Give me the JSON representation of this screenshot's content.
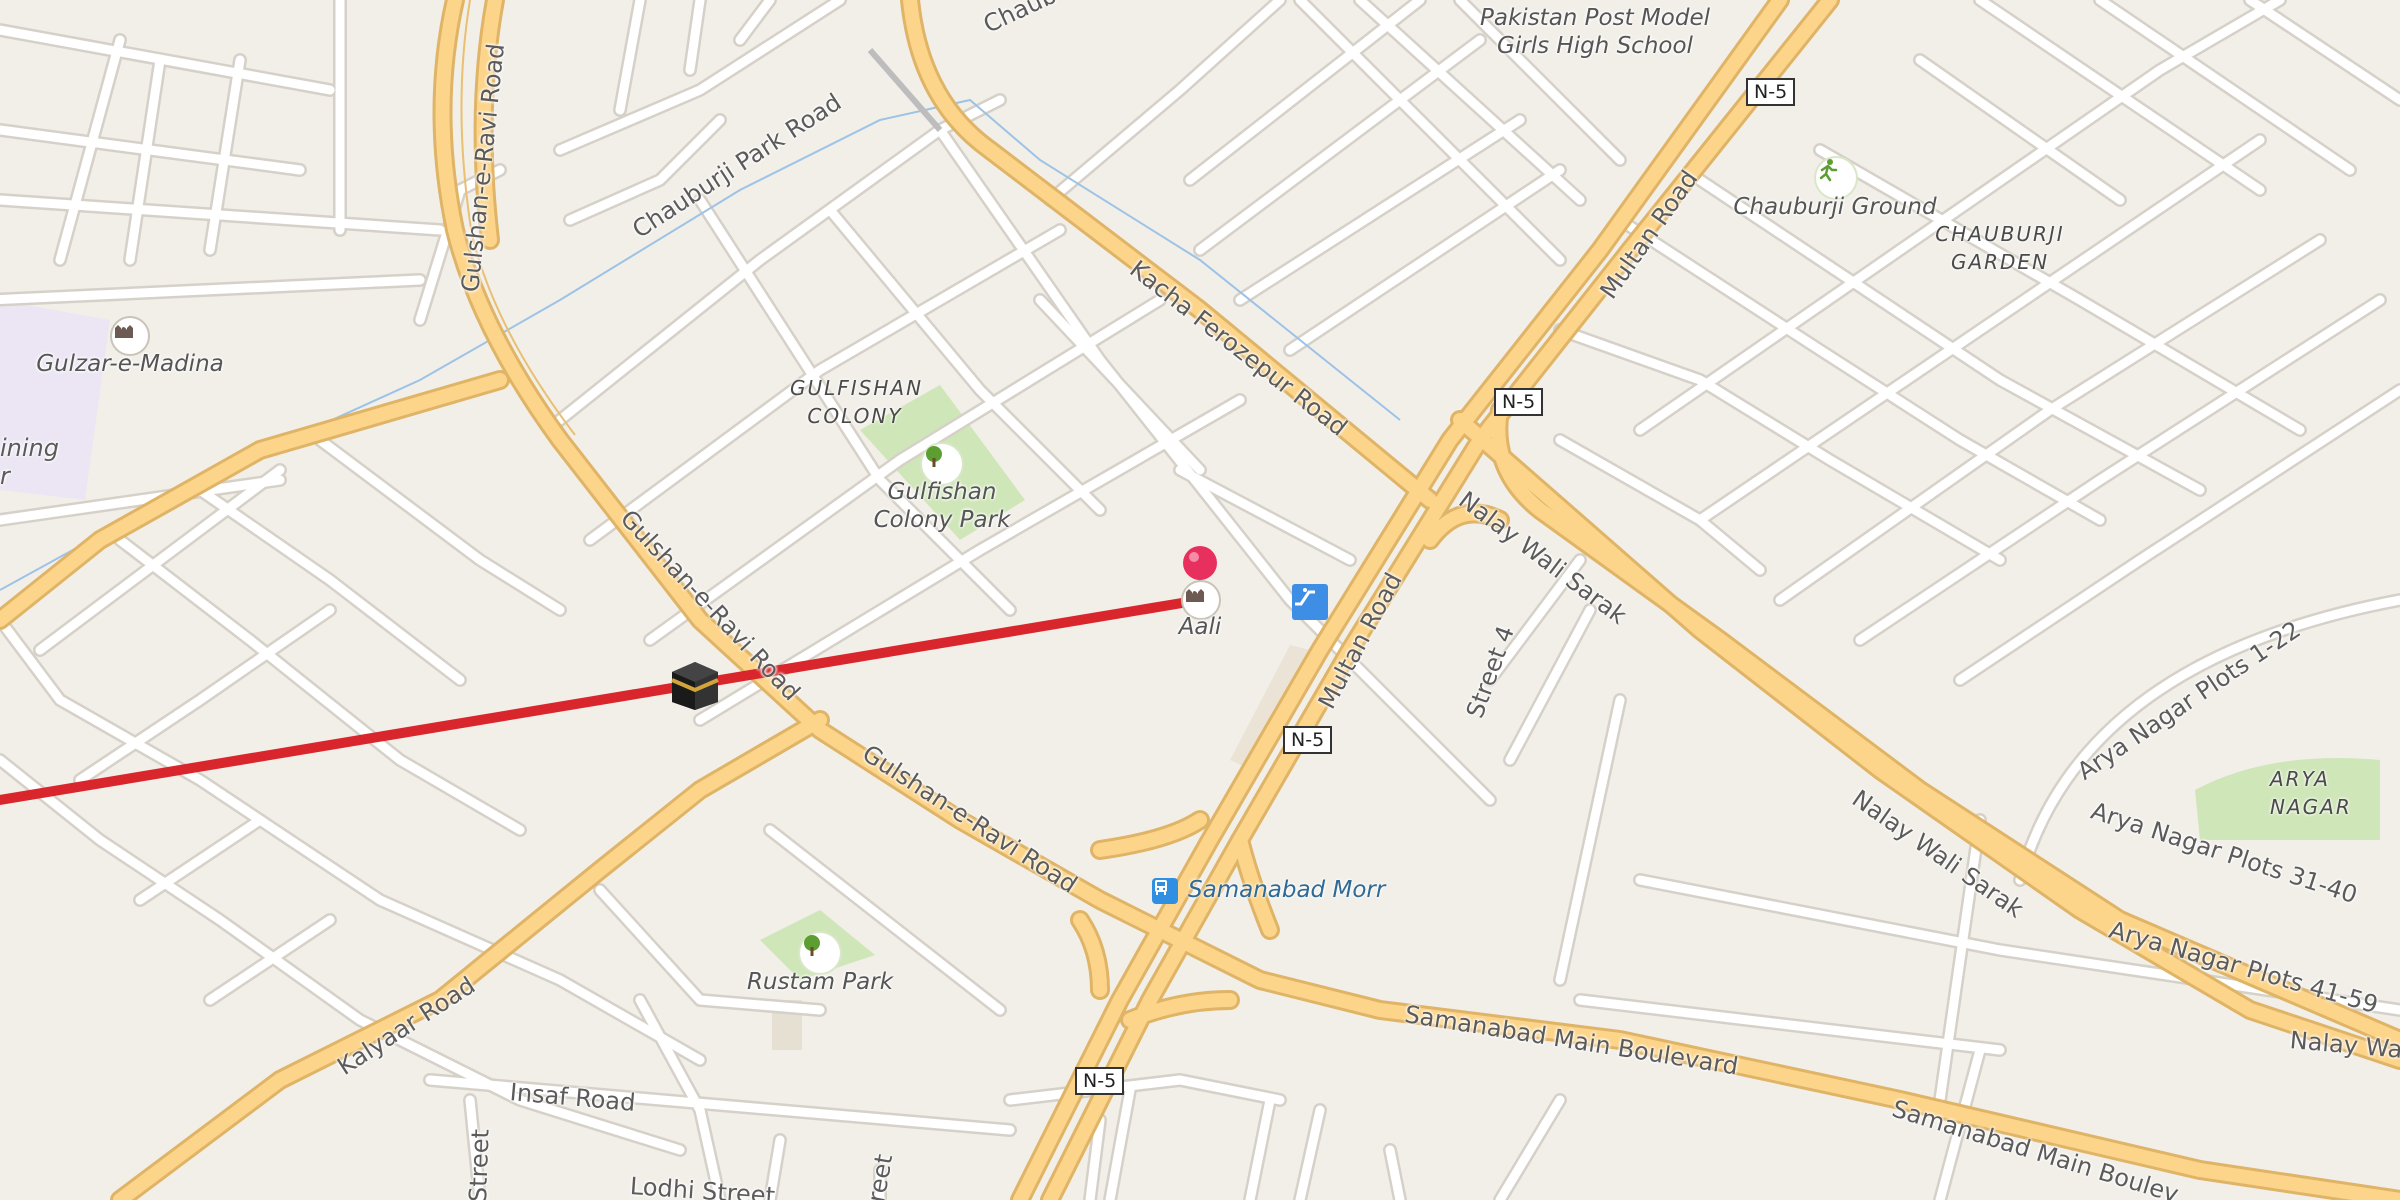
{
  "colors": {
    "background": "#f2efe9",
    "major_road": "#fcd58b",
    "qibla_line": "#d9262c",
    "pin": "#e8305f",
    "park": "#cfe6b8",
    "bus_stop": "#2f8fe0"
  },
  "markers": {
    "location_pin": {
      "name": "location-pin-icon"
    },
    "kaaba": {
      "name": "kaaba-icon"
    },
    "qibla_line": {
      "name": "qibla-direction-line"
    }
  },
  "roads": {
    "gulshan_ravi_1": "Gulshan-e-Ravi Road",
    "gulshan_ravi_2": "Gulshan-e-Ravi Road",
    "gulshan_ravi_3": "Gulshan-e-Ravi Road",
    "chauburji_park": "Chauburji Park Road",
    "chaub_cut": "Chaub",
    "kacha_ferozepur": "Kacha Ferozepur Road",
    "multan_1": "Multan Road",
    "multan_2": "Multan Road",
    "nalay_wali_1": "Nalay Wali Sarak",
    "nalay_wali_2": "Nalay Wali Sarak",
    "nalay_wali_3": "Nalay Wal",
    "street_4": "Street 4",
    "samanabad_blvd_1": "Samanabad Main Boulevard",
    "samanabad_blvd_2": "Samanabad Main Boulev",
    "kalyaar": "Kalyaar Road",
    "insaf": "Insaf Road",
    "lodhi": "Lodhi Street",
    "street_v": "Street",
    "reet_v": "reet",
    "arya_1": "Arya Nagar Plots 1-22",
    "arya_31": "Arya Nagar Plots 31-40",
    "arya_41": "Arya Nagar Plots 41-59"
  },
  "shields": {
    "n5_top": "N-5",
    "n5_mid": "N-5",
    "n5_center": "N-5",
    "n5_bottom": "N-5"
  },
  "areas": {
    "gulfishan_colony": "GULFISHAN COLONY",
    "chauburji_garden": "CHAUBURJI GARDEN",
    "arya_nagar": "ARYA NAGAR"
  },
  "pois": {
    "pakistan_post": "Pakistan Post Model Girls High School",
    "chauburji_ground": "Chauburji Ground",
    "gulzar_madina": "Gulzar-e-Madina",
    "gulfishan_park": "Gulfishan Colony Park",
    "aali": "Aali",
    "samanabad_morr": "Samanabad Morr",
    "rustam_park": "Rustam Park",
    "training_cut": "ining",
    "training_cut_2": "r"
  }
}
